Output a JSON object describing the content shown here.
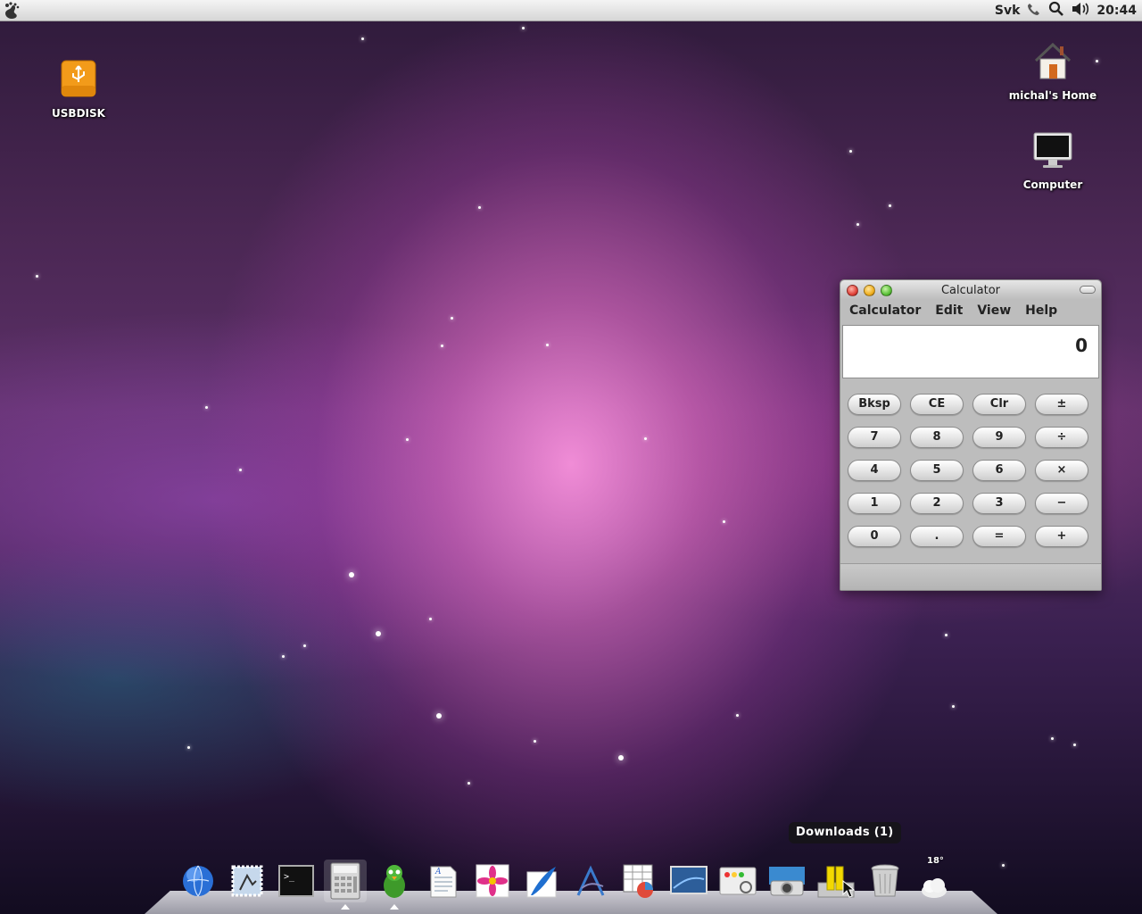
{
  "top_panel": {
    "keyboard_layout": "Svk",
    "clock": "20:44",
    "icons": [
      "gnome-foot-icon",
      "phone-icon",
      "search-icon",
      "volume-icon"
    ]
  },
  "desktop_icons": [
    {
      "name": "usbdisk",
      "label": "USBDISK",
      "icon": "usb-drive-icon"
    },
    {
      "name": "home",
      "label": "michal's Home",
      "icon": "home-folder-icon"
    },
    {
      "name": "computer",
      "label": "Computer",
      "icon": "computer-icon"
    }
  ],
  "calculator": {
    "title": "Calculator",
    "menu": [
      "Calculator",
      "Edit",
      "View",
      "Help"
    ],
    "display": "0",
    "buttons": [
      [
        "Bksp",
        "CE",
        "Clr",
        "±"
      ],
      [
        "7",
        "8",
        "9",
        "÷"
      ],
      [
        "4",
        "5",
        "6",
        "×"
      ],
      [
        "1",
        "2",
        "3",
        "−"
      ],
      [
        "0",
        ".",
        "=",
        "+"
      ]
    ]
  },
  "tooltip": "Downloads (1)",
  "dock": {
    "items": [
      "browser-globe-icon",
      "mail-stamp-icon",
      "terminal-icon",
      "calculator-icon",
      "pidgin-icon",
      "text-editor-icon",
      "photo-flower-icon",
      "quill-writer-icon",
      "vector-draw-icon",
      "spreadsheet-chart-icon",
      "desktop-screen-icon",
      "screenshot-icon",
      "camera-icon",
      "downloads-icon",
      "trash-icon",
      "weather-icon"
    ],
    "weather_temp": "18°"
  }
}
